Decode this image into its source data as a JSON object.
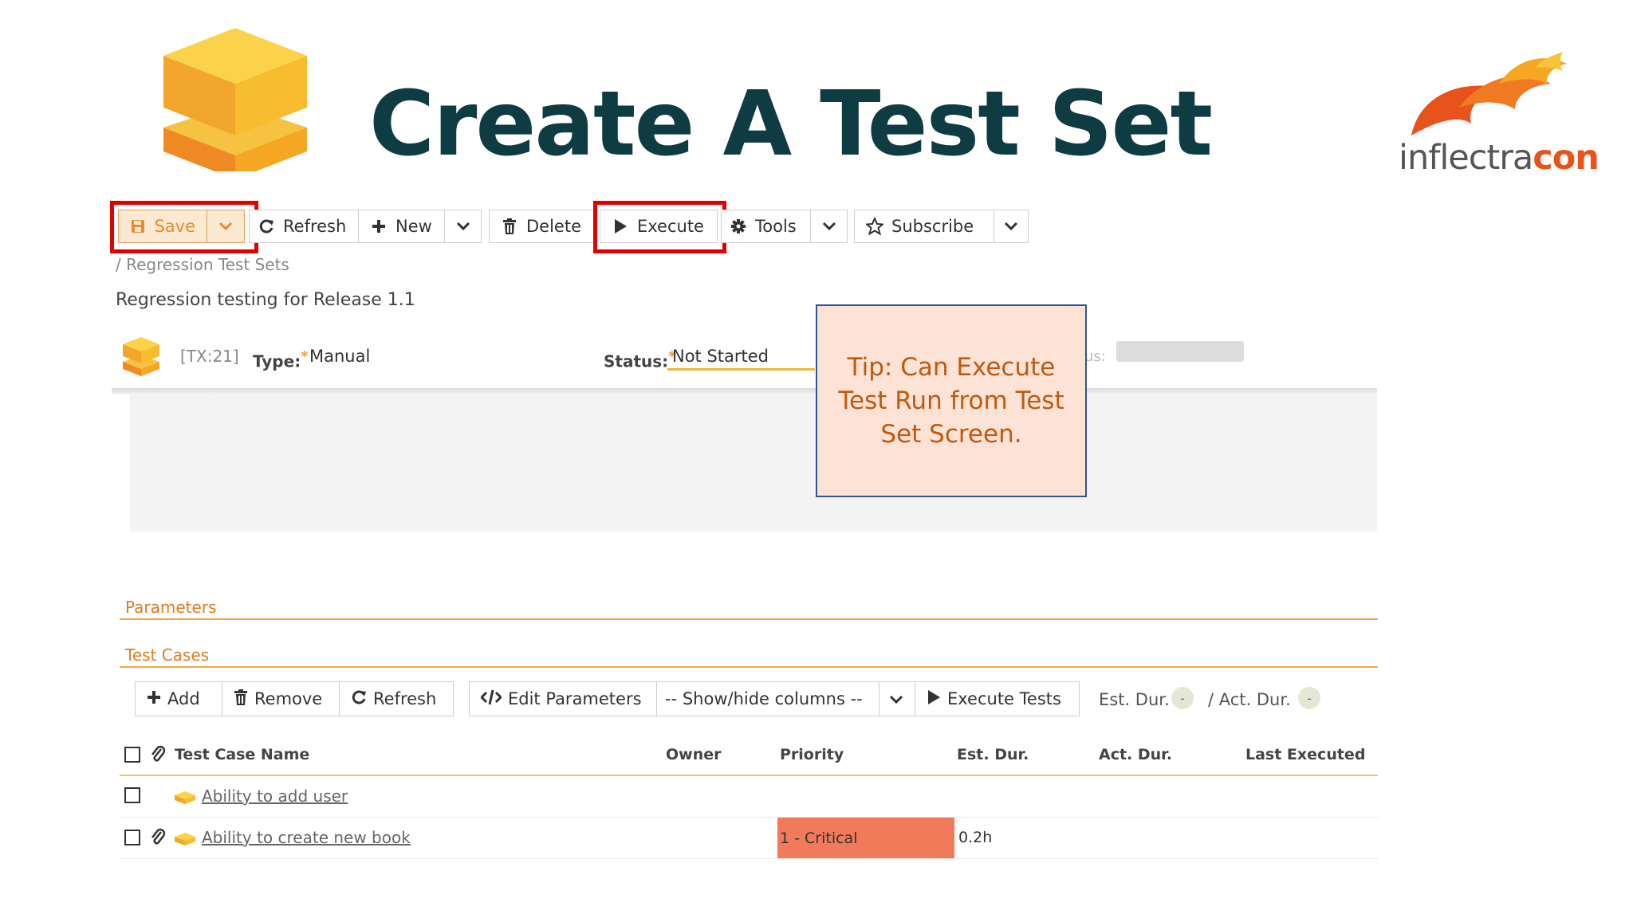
{
  "slide": {
    "title": "Create A Test Set",
    "brand_part1": "inflectra",
    "brand_part2": "con"
  },
  "toolbar": {
    "save_label": "Save",
    "refresh_label": "Refresh",
    "new_label": "New",
    "delete_label": "Delete",
    "execute_label": "Execute",
    "tools_label": "Tools",
    "subscribe_label": "Subscribe"
  },
  "breadcrumb": "/ Regression Test Sets",
  "test_set": {
    "name": "Regression testing for Release 1.1",
    "id": "[TX:21]",
    "type_label": "Type:",
    "type_required": "*",
    "type_value": "Manual",
    "status_label": "Status:",
    "status_required": "*",
    "status_value": "Not Started",
    "faded_label": "us:"
  },
  "tip": {
    "text": "Tip:  Can Execute Test Run from Test Set Screen."
  },
  "sections": {
    "parameters": "Parameters",
    "test_cases": "Test Cases"
  },
  "tc_toolbar": {
    "add_label": "Add",
    "remove_label": "Remove",
    "refresh_label": "Refresh",
    "edit_params_label": "Edit Parameters",
    "show_hide_label": "-- Show/hide columns --",
    "execute_tests_label": "Execute Tests",
    "est_dur_label": "Est. Dur.",
    "est_dur_value": "-",
    "act_dur_label": "/  Act. Dur.",
    "act_dur_value": "-"
  },
  "table": {
    "columns": [
      "Test Case Name",
      "Owner",
      "Priority",
      "Est. Dur.",
      "Act. Dur.",
      "Last Executed"
    ],
    "rows": [
      {
        "name": "Ability to add user",
        "has_attachment": false,
        "priority": "",
        "est_dur": ""
      },
      {
        "name": "Ability to create new book",
        "has_attachment": true,
        "priority": "1 - Critical",
        "est_dur": "0.2h"
      }
    ]
  },
  "colors": {
    "title": "#0f3c43",
    "highlight": "#e00000",
    "section": "#e07b20",
    "critical": "#f07a5a",
    "tip_bg": "#fde3d6",
    "tip_border": "#2f5597"
  }
}
